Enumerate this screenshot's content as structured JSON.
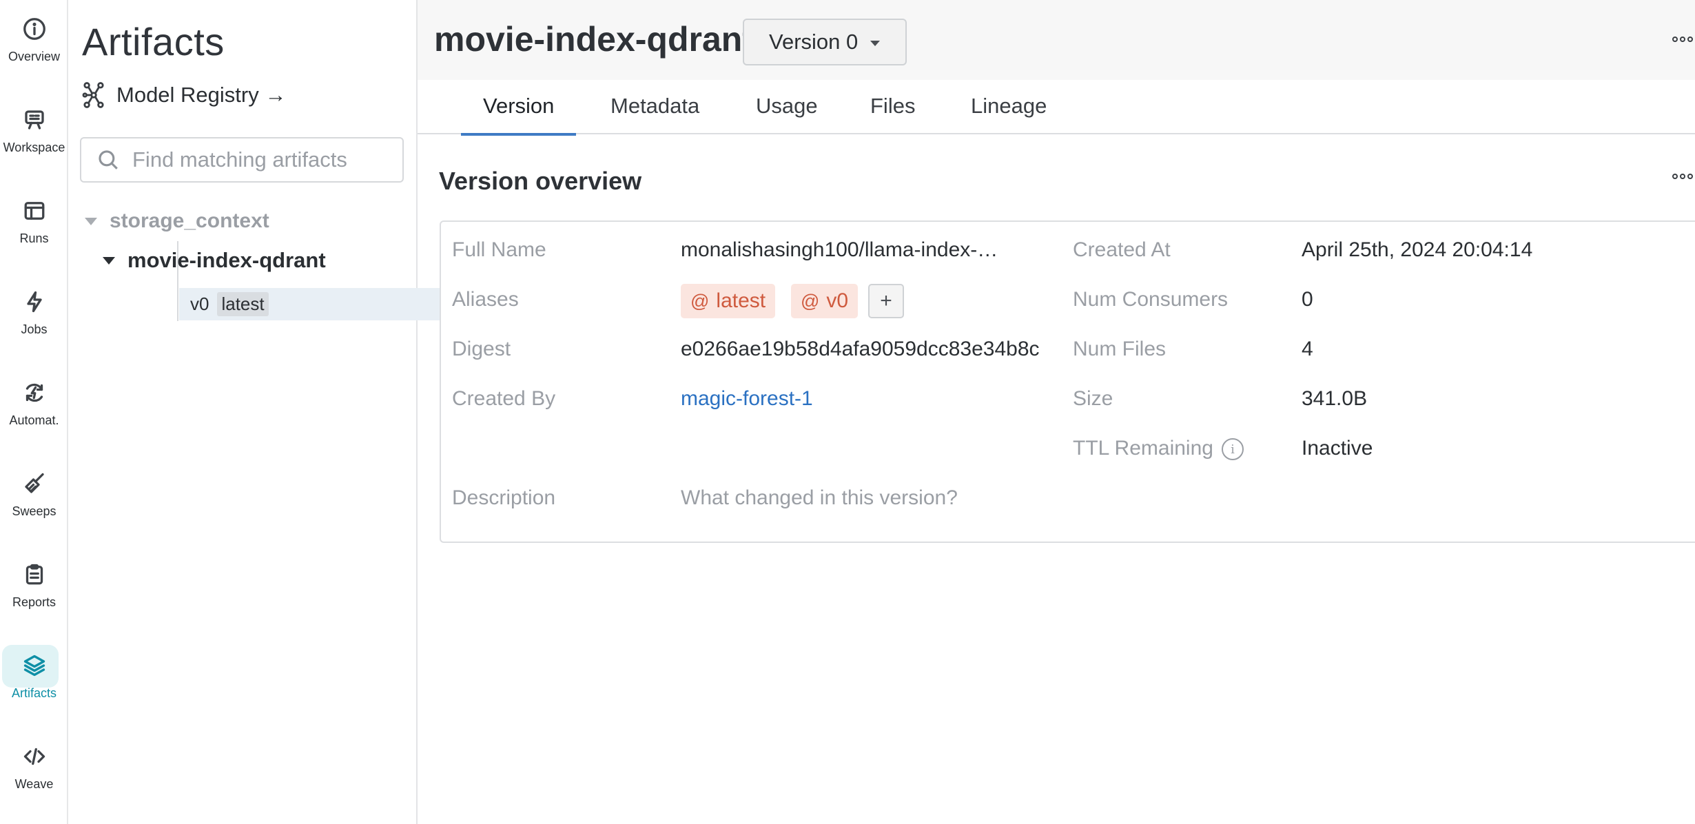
{
  "rail": {
    "items": [
      {
        "label": "Overview",
        "icon": "info-icon"
      },
      {
        "label": "Workspace",
        "icon": "workspace-icon"
      },
      {
        "label": "Runs",
        "icon": "runs-table-icon"
      },
      {
        "label": "Jobs",
        "icon": "lightning-icon"
      },
      {
        "label": "Automat.",
        "icon": "automation-icon"
      },
      {
        "label": "Sweeps",
        "icon": "broom-icon"
      },
      {
        "label": "Reports",
        "icon": "clipboard-icon"
      },
      {
        "label": "Artifacts",
        "icon": "layers-icon",
        "active": true
      },
      {
        "label": "Weave",
        "icon": "code-icon"
      }
    ]
  },
  "panel": {
    "title": "Artifacts",
    "registry_link": "Model Registry →",
    "search_placeholder": "Find matching artifacts",
    "tree": {
      "type_name": "storage_context",
      "artifact_name": "movie-index-qdrant",
      "version": "v0",
      "version_tag": "latest"
    }
  },
  "header": {
    "title": "movie-index-qdrant",
    "version_select": "Version 0"
  },
  "tabs": [
    "Version",
    "Metadata",
    "Usage",
    "Files",
    "Lineage"
  ],
  "active_tab": "Version",
  "overview": {
    "title": "Version overview",
    "full_name_label": "Full Name",
    "full_name": "monalishasingh100/llama-index-…",
    "aliases_label": "Aliases",
    "aliases": [
      "latest",
      "v0"
    ],
    "add_alias": "+",
    "digest_label": "Digest",
    "digest": "e0266ae19b58d4afa9059dcc83e34b8c",
    "created_by_label": "Created By",
    "created_by": "magic-forest-1",
    "description_label": "Description",
    "description_placeholder": "What changed in this version?",
    "created_at_label": "Created At",
    "created_at": "April 25th, 2024 20:04:14",
    "num_consumers_label": "Num Consumers",
    "num_consumers": "0",
    "num_files_label": "Num Files",
    "num_files": "4",
    "size_label": "Size",
    "size": "341.0B",
    "ttl_label": "TTL Remaining",
    "ttl": "Inactive"
  },
  "colors": {
    "accent": "#0e8fa6",
    "tab_underline": "#3f7bc4",
    "link": "#2b71c2",
    "alias_bg": "#fbe5df",
    "alias_text": "#cf5a3e"
  }
}
